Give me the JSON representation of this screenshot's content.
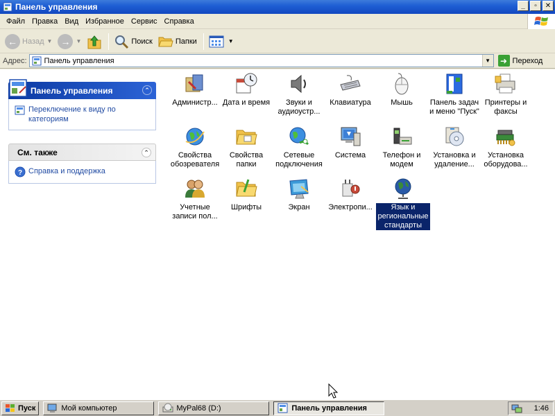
{
  "window": {
    "title": "Панель управления",
    "controls": {
      "minimize": "_",
      "maximize": "▫",
      "close": "✕"
    }
  },
  "menu": [
    "Файл",
    "Правка",
    "Вид",
    "Избранное",
    "Сервис",
    "Справка"
  ],
  "toolbar": {
    "back": "Назад",
    "search": "Поиск",
    "folders": "Папки"
  },
  "address": {
    "label": "Адрес:",
    "value": "Панель управления",
    "go": "Переход"
  },
  "panes": {
    "control_panel": {
      "title": "Панель управления",
      "tasks": [
        {
          "label": "Переключение к виду по категориям",
          "icon": "switch-view-icon"
        }
      ]
    },
    "see_also": {
      "title": "См. также",
      "tasks": [
        {
          "label": "Справка и поддержка",
          "icon": "help-icon"
        }
      ]
    }
  },
  "items": [
    {
      "label": "Администр...",
      "icon": "admin-tools-icon"
    },
    {
      "label": "Дата и время",
      "icon": "date-time-icon"
    },
    {
      "label": "Звуки и аудиоустр...",
      "icon": "sounds-icon"
    },
    {
      "label": "Клавиатура",
      "icon": "keyboard-icon"
    },
    {
      "label": "Мышь",
      "icon": "mouse-icon"
    },
    {
      "label": "Панель задач и меню \"Пуск\"",
      "icon": "taskbar-icon"
    },
    {
      "label": "Принтеры и факсы",
      "icon": "printers-icon"
    },
    {
      "label": "Свойства обозревателя",
      "icon": "internet-options-icon"
    },
    {
      "label": "Свойства папки",
      "icon": "folder-options-icon"
    },
    {
      "label": "Сетевые подключения",
      "icon": "network-icon"
    },
    {
      "label": "Система",
      "icon": "system-icon"
    },
    {
      "label": "Телефон и модем",
      "icon": "phone-modem-icon"
    },
    {
      "label": "Установка и удаление...",
      "icon": "add-remove-icon"
    },
    {
      "label": "Установка оборудова...",
      "icon": "add-hardware-icon"
    },
    {
      "label": "Учетные записи пол...",
      "icon": "user-accounts-icon"
    },
    {
      "label": "Шрифты",
      "icon": "fonts-icon"
    },
    {
      "label": "Экран",
      "icon": "display-icon"
    },
    {
      "label": "Электропи...",
      "icon": "power-icon"
    },
    {
      "label": "Язык и региональные стандарты",
      "icon": "regional-icon",
      "selected": true
    }
  ],
  "taskbar": {
    "start": "Пуск",
    "tasks": [
      {
        "label": "Мой компьютер",
        "icon": "my-computer-icon"
      },
      {
        "label": "MyPal68 (D:)",
        "icon": "drive-icon"
      },
      {
        "label": "Панель управления",
        "icon": "control-panel-icon",
        "active": true
      }
    ],
    "clock": "1:46"
  },
  "colors": {
    "title_bar": "#1f5fd4",
    "pane_header": "#0c3aa3",
    "task_link": "#214ba3",
    "selection": "#0a246a",
    "go_button": "#3aa135"
  }
}
